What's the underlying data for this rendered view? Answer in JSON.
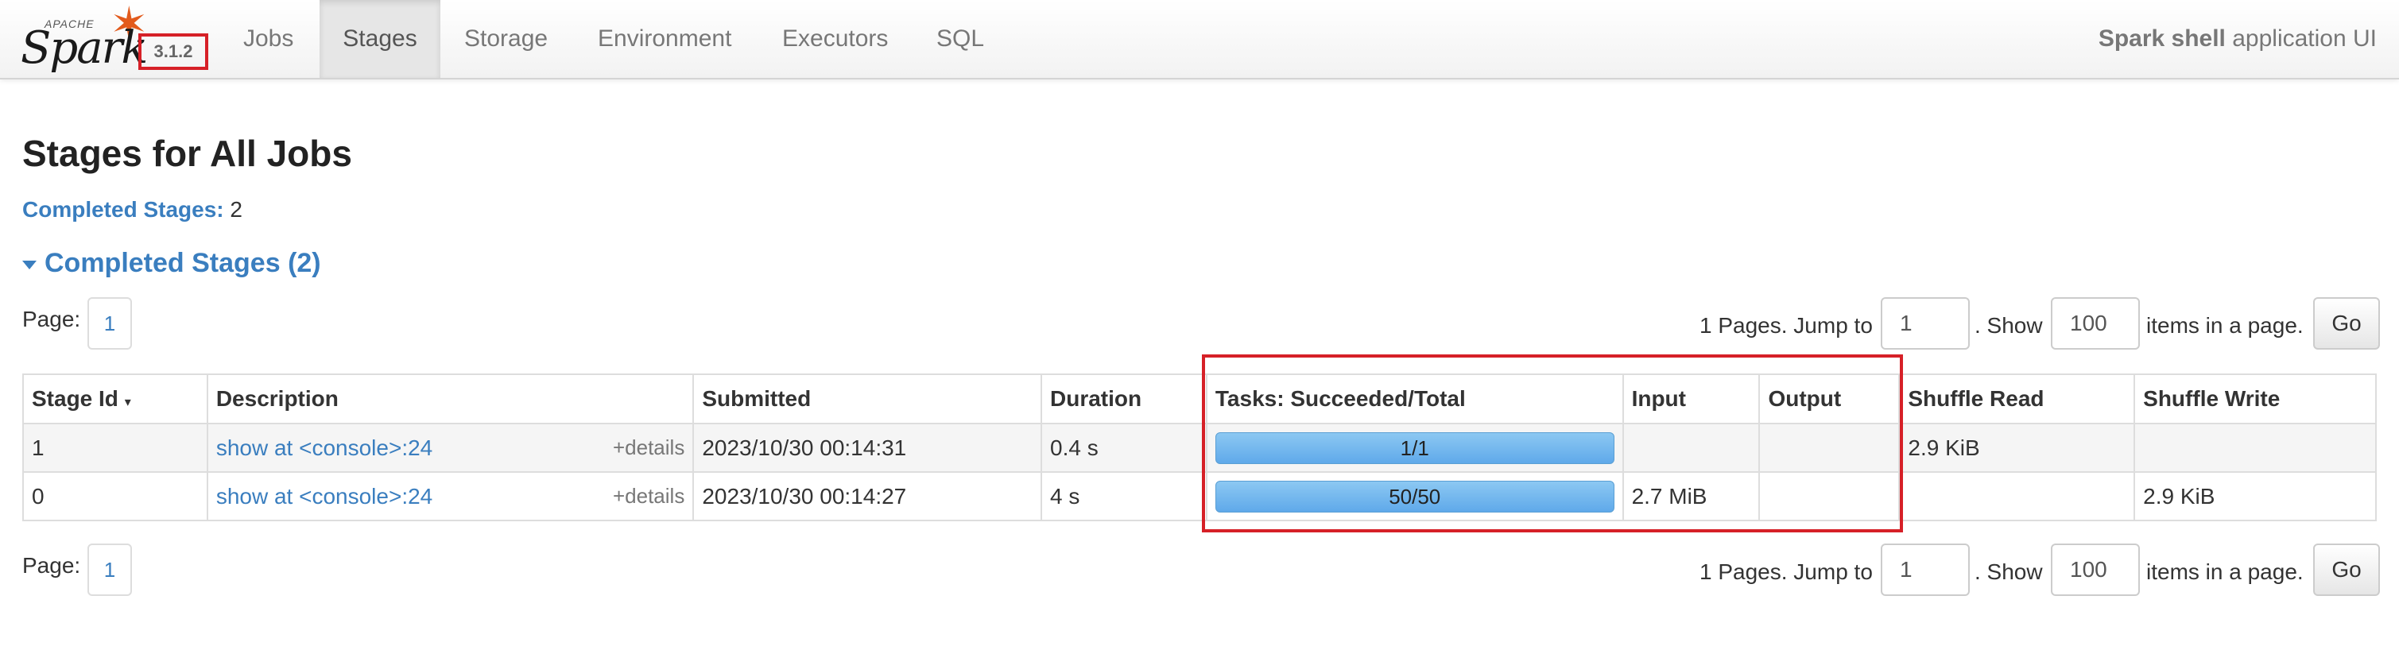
{
  "nav": {
    "logo_apache": "APACHE",
    "logo_text": "Spark",
    "version": "3.1.2",
    "tabs": [
      "Jobs",
      "Stages",
      "Storage",
      "Environment",
      "Executors",
      "SQL"
    ],
    "active_tab": "Stages",
    "app_title_bold": "Spark shell",
    "app_title_rest": " application UI"
  },
  "page": {
    "title": "Stages for All Jobs",
    "summary_label": "Completed Stages:",
    "summary_value": "2",
    "section_title": "Completed Stages (2)"
  },
  "pager": {
    "page_label": "Page:",
    "current_page": "1",
    "pages_text": "1 Pages. Jump to",
    "jump_value": "1",
    "show_text": ". Show",
    "show_value": "100",
    "items_text": "items in a page.",
    "go_label": "Go"
  },
  "table": {
    "headers": [
      "Stage Id",
      "Description",
      "Submitted",
      "Duration",
      "Tasks: Succeeded/Total",
      "Input",
      "Output",
      "Shuffle Read",
      "Shuffle Write"
    ],
    "sort_indicator": "▾",
    "details_label": "+details",
    "rows": [
      {
        "stage_id": "1",
        "description": "show at <console>:24",
        "submitted": "2023/10/30 00:14:31",
        "duration": "0.4 s",
        "tasks": "1/1",
        "tasks_fraction": 1.0,
        "input": "",
        "output": "",
        "shuffle_read": "2.9 KiB",
        "shuffle_write": ""
      },
      {
        "stage_id": "0",
        "description": "show at <console>:24",
        "submitted": "2023/10/30 00:14:27",
        "duration": "4 s",
        "tasks": "50/50",
        "tasks_fraction": 1.0,
        "input": "2.7 MiB",
        "output": "",
        "shuffle_read": "",
        "shuffle_write": "2.9 KiB"
      }
    ]
  },
  "colors": {
    "link": "#3a7ebf",
    "highlight": "#d62027",
    "progress": "#5fa9ea",
    "spark_orange": "#e25a1c"
  }
}
